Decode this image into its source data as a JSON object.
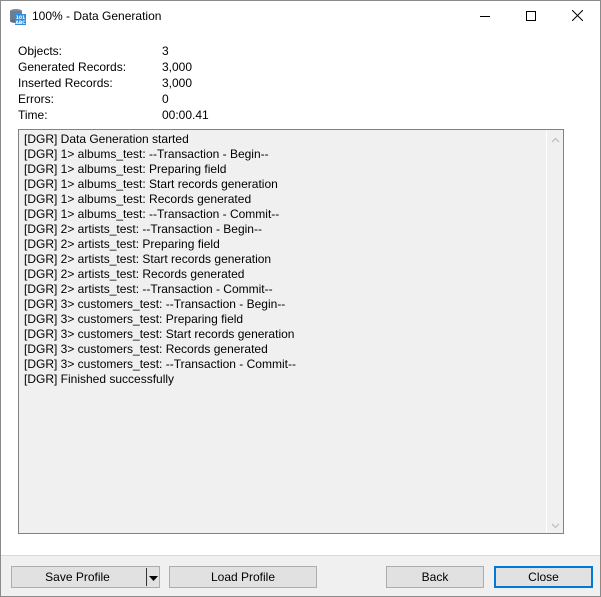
{
  "window": {
    "title": "100% - Data Generation",
    "icon": "database-101-abc-icon",
    "controls": {
      "minimize": "minimize-icon",
      "maximize": "maximize-icon",
      "close": "close-icon"
    }
  },
  "stats": [
    {
      "label": "Objects:",
      "value": "3"
    },
    {
      "label": "Generated Records:",
      "value": "3,000"
    },
    {
      "label": "Inserted Records:",
      "value": "3,000"
    },
    {
      "label": "Errors:",
      "value": "0"
    },
    {
      "label": "Time:",
      "value": "00:00.41"
    }
  ],
  "log": [
    "[DGR] Data Generation started",
    "[DGR] 1> albums_test: --Transaction - Begin--",
    "[DGR] 1> albums_test: Preparing field",
    "[DGR] 1> albums_test: Start records generation",
    "[DGR] 1> albums_test: Records generated",
    "[DGR] 1> albums_test: --Transaction - Commit--",
    "[DGR] 2> artists_test: --Transaction - Begin--",
    "[DGR] 2> artists_test: Preparing field",
    "[DGR] 2> artists_test: Start records generation",
    "[DGR] 2> artists_test: Records generated",
    "[DGR] 2> artists_test: --Transaction - Commit--",
    "[DGR] 3> customers_test: --Transaction - Begin--",
    "[DGR] 3> customers_test: Preparing field",
    "[DGR] 3> customers_test: Start records generation",
    "[DGR] 3> customers_test: Records generated",
    "[DGR] 3> customers_test: --Transaction - Commit--",
    "[DGR] Finished successfully"
  ],
  "footer": {
    "save_profile": "Save Profile",
    "load_profile": "Load Profile",
    "back": "Back",
    "close": "Close"
  },
  "colors": {
    "accent": "#0078d7",
    "button_bg": "#e1e1e1",
    "panel_bg": "#f0f0f0"
  }
}
